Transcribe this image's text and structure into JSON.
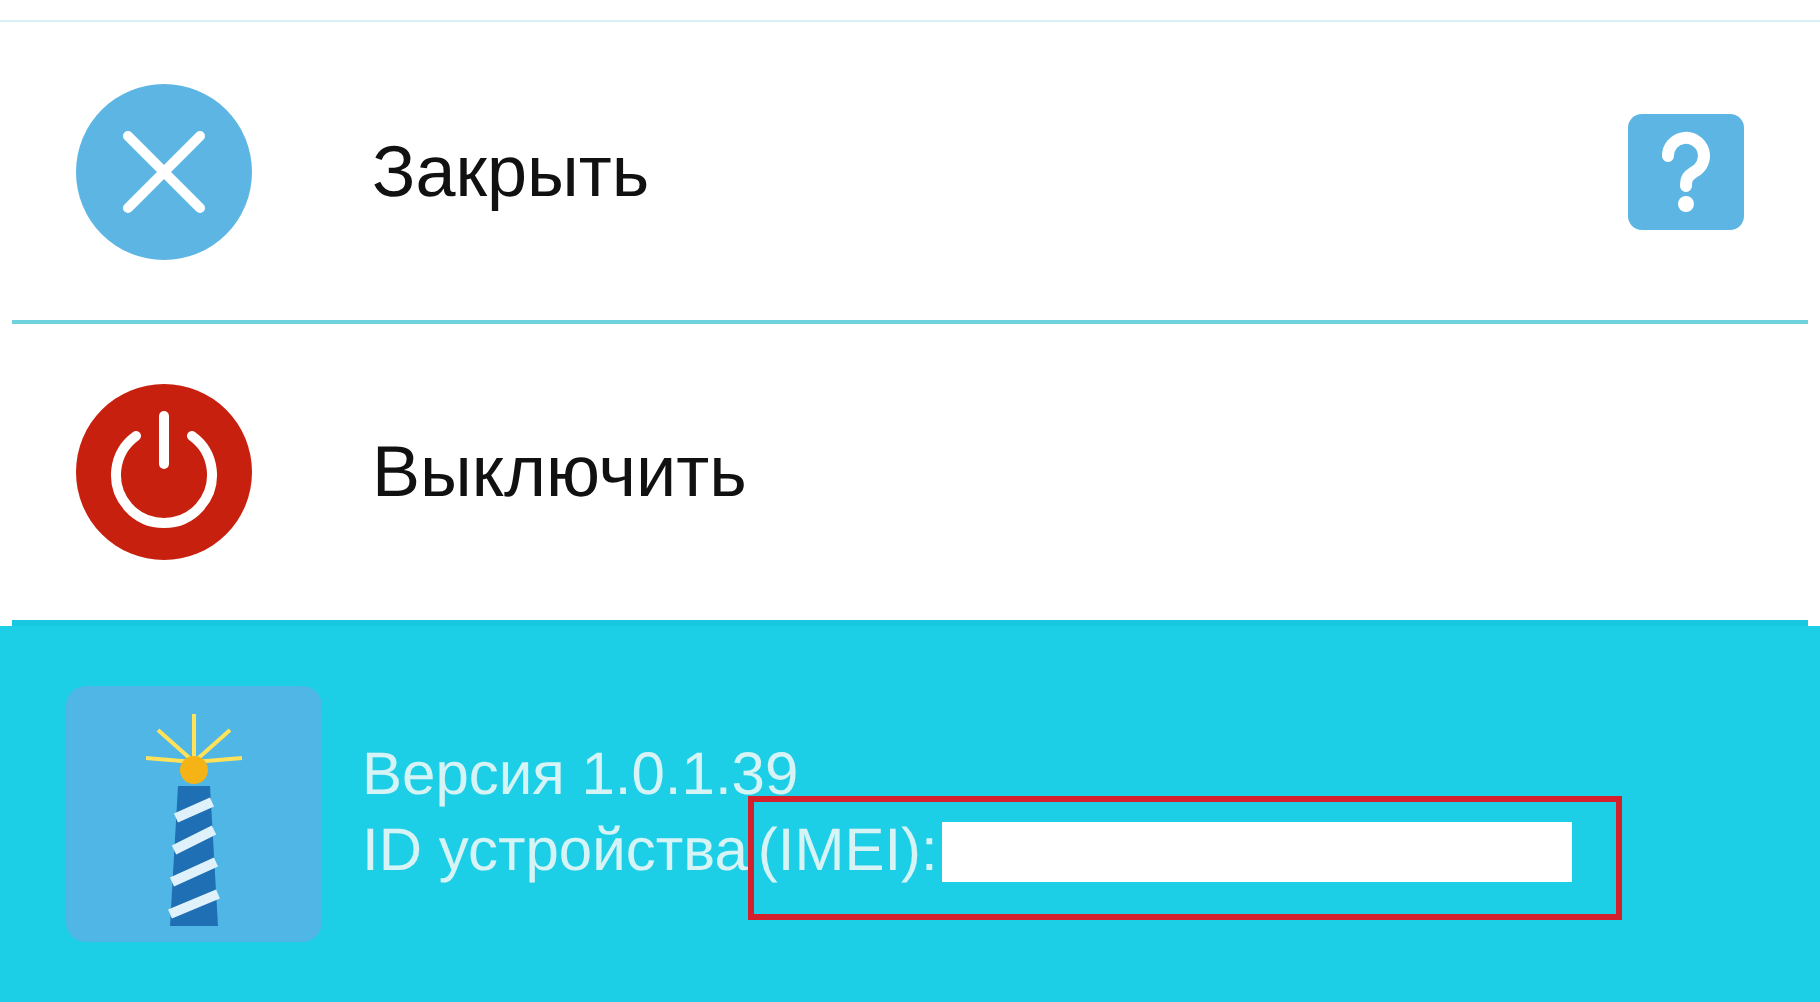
{
  "menu_items": [
    {
      "kind": "close",
      "label": "Закрыть",
      "help": true
    },
    {
      "kind": "power",
      "label": "Выключить",
      "help": false
    }
  ],
  "footer": {
    "version": "Версия 1.0.1.39",
    "device_id_label": "ID устройства",
    "device_id_key": "(IMEI):"
  }
}
